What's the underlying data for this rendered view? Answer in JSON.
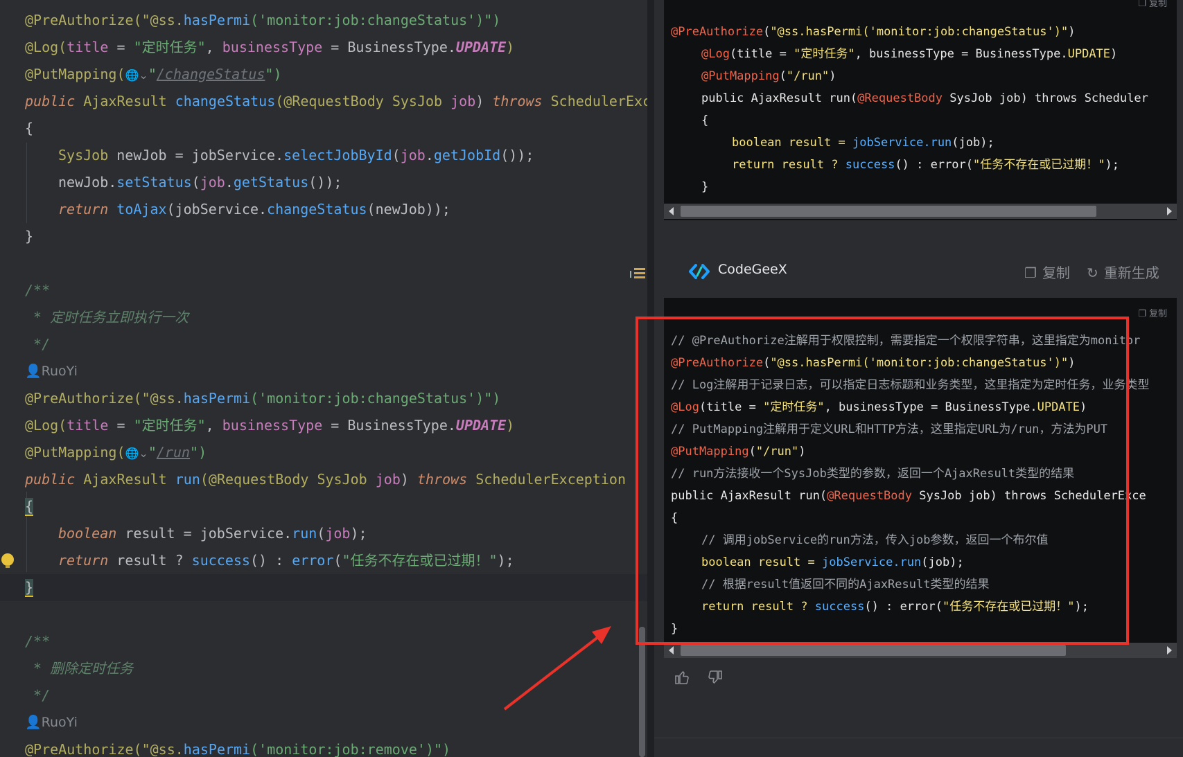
{
  "editor": {
    "lines": {
      "l1": {
        "pre": "@PreAuthorize(\"@ss.",
        "meth": "hasPermi",
        "mid": "('monitor:job:changeStatus')\")"
      },
      "l2": {
        "a": "@Log(",
        "b": "title",
        "c": " = ",
        "d": "\"定时任务\"",
        "e": ", ",
        "f": "businessType",
        "g": " = BusinessType.",
        "h": "UPDATE",
        "i": ")"
      },
      "l3": {
        "a": "@PutMapping(",
        "b": "\"",
        "link": "/changeStatus",
        "c": "\")"
      },
      "l4": {
        "a": "public ",
        "b": "AjaxResult ",
        "c": "changeStatus",
        "d": "(@RequestBody ",
        "e": "SysJob ",
        "f": "job",
        "g": ") ",
        "h": "throws ",
        "i": "SchedulerExc"
      },
      "l5": "{",
      "l6": {
        "a": "SysJob ",
        "b": "newJob = jobService.",
        "c": "selectJobById",
        "d": "(",
        "e": "job",
        "f": ".",
        "g": "getJobId",
        "h": "());"
      },
      "l7": {
        "a": "newJob.",
        "b": "setStatus",
        "c": "(",
        "d": "job",
        "e": ".",
        "f": "getStatus",
        "g": "());"
      },
      "l8": {
        "a": "return ",
        "b": "toAjax",
        "c": "(jobService.",
        "d": "changeStatus",
        "e": "(newJob));"
      },
      "l9": "}",
      "l11": "/**",
      "l12": " * 定时任务立即执行一次",
      "l13": " */",
      "author1": "RuoYi",
      "l15": {
        "pre": "@PreAuthorize(\"@ss.",
        "meth": "hasPermi",
        "mid": "('monitor:job:changeStatus')\")"
      },
      "l16": {
        "a": "@Log(",
        "b": "title",
        "c": " = ",
        "d": "\"定时任务\"",
        "e": ", ",
        "f": "businessType",
        "g": " = BusinessType.",
        "h": "UPDATE",
        "i": ")"
      },
      "l17": {
        "a": "@PutMapping(",
        "b": "\"",
        "link": "/run",
        "c": "\")"
      },
      "l18": {
        "a": "public ",
        "b": "AjaxResult ",
        "c": "run",
        "d": "(@RequestBody ",
        "e": "SysJob ",
        "f": "job",
        "g": ") ",
        "h": "throws ",
        "i": "SchedulerException"
      },
      "l19": "{",
      "l20": {
        "a": "boolean ",
        "b": "result = jobService.",
        "c": "run",
        "d": "(",
        "e": "job",
        "f": ");"
      },
      "l21": {
        "a": "return ",
        "b": "result ? ",
        "c": "success",
        "d": "() : ",
        "e": "error",
        "f": "(",
        "g": "\"任务不存在或已过期！\"",
        "h": ");"
      },
      "l22": "}",
      "l24": "/**",
      "l25": " * 删除定时任务",
      "l26": " */",
      "author2": "RuoYi",
      "l28": {
        "pre": "@PreAuthorize(\"@ss.",
        "meth": "hasPermi",
        "mid": "('monitor:job:remove')\")"
      }
    }
  },
  "panel": {
    "copy_small_label": "复制",
    "top_code": {
      "l1": {
        "a": "@PreAuthorize",
        "b": "(",
        "c": "\"@ss.hasPermi('monitor:job:changeStatus')\"",
        "d": ")"
      },
      "l2": {
        "a": "@Log",
        "b": "(title = ",
        "c": "\"定时任务\"",
        "d": ", businessType = BusinessType.",
        "e": "UPDATE",
        "f": ")"
      },
      "l3": {
        "a": "@PutMapping",
        "b": "(",
        "c": "\"/run\"",
        "d": ")"
      },
      "l4": {
        "a": "public AjaxResult run(",
        "b": "@RequestBody",
        "c": " SysJob job) throws Scheduler"
      },
      "l5": "{",
      "l6": {
        "a": "boolean result = ",
        "b": "jobService.run",
        "c": "(job);"
      },
      "l7": {
        "a": "return result ? ",
        "b": "success",
        "c": "() : error(",
        "d": "\"任务不存在或已过期！\"",
        "e": ");"
      },
      "l8": "}"
    },
    "header": {
      "brand": "CodeGeeX",
      "copy_label": "复制",
      "regen_label": "重新生成"
    },
    "answer_code": {
      "c1": "// @PreAuthorize注解用于权限控制，需要指定一个权限字符串，这里指定为monitor",
      "l2": {
        "a": "@PreAuthorize",
        "b": "(",
        "c": "\"@ss.hasPermi('monitor:job:changeStatus')\"",
        "d": ")"
      },
      "c3": "// Log注解用于记录日志，可以指定日志标题和业务类型，这里指定为定时任务，业务类型",
      "l4": {
        "a": "@Log",
        "b": "(title = ",
        "c": "\"定时任务\"",
        "d": ", businessType = BusinessType.",
        "e": "UPDATE",
        "f": ")"
      },
      "c5": "// PutMapping注解用于定义URL和HTTP方法，这里指定URL为/run，方法为PUT",
      "l6": {
        "a": "@PutMapping",
        "b": "(",
        "c": "\"/run\"",
        "d": ")"
      },
      "c7": "// run方法接收一个SysJob类型的参数，返回一个AjaxResult类型的结果",
      "l8": {
        "a": "public AjaxResult run(",
        "b": "@RequestBody",
        "c": " SysJob job) throws SchedulerExce"
      },
      "l9": "{",
      "c10": "// 调用jobService的run方法，传入job参数，返回一个布尔值",
      "l11": {
        "a": "boolean result = ",
        "b": "jobService.run",
        "c": "(job);"
      },
      "c12": "// 根据result值返回不同的AjaxResult类型的结果",
      "l13": {
        "a": "return result ? ",
        "b": "success",
        "c": "() : error(",
        "d": "\"任务不存在或已过期！\"",
        "e": ");"
      },
      "l14": "}"
    },
    "feedback": {
      "like_icon": "thumbs-up-icon",
      "dislike_icon": "thumbs-down-icon"
    }
  },
  "colors": {
    "annotation_box": "#e8322a",
    "accent": "#1ea0ff"
  }
}
